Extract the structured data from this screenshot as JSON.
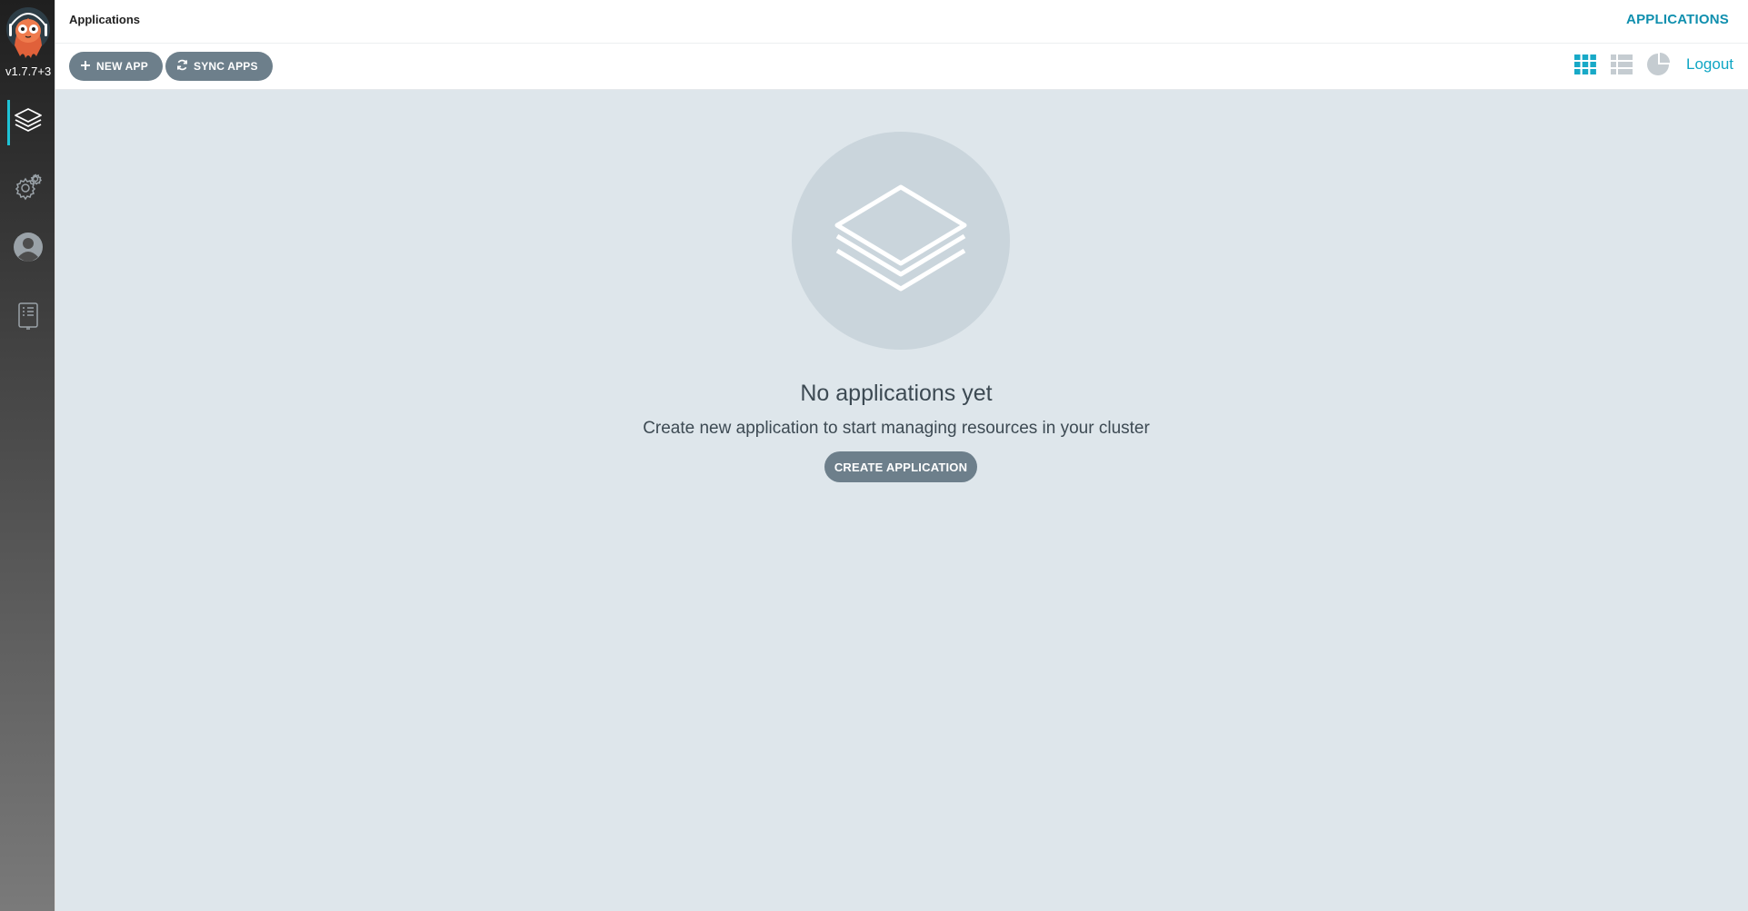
{
  "sidebar": {
    "version": "v1.7.7+3",
    "items": [
      {
        "name": "applications",
        "icon": "layers-icon"
      },
      {
        "name": "settings",
        "icon": "gear-icon"
      },
      {
        "name": "user-info",
        "icon": "user-icon"
      },
      {
        "name": "docs",
        "icon": "book-icon"
      }
    ]
  },
  "header": {
    "title": "Applications",
    "section": "APPLICATIONS"
  },
  "toolbar": {
    "new_app_label": "NEW APP",
    "sync_apps_label": "SYNC APPS",
    "logout_label": "Logout",
    "views": [
      "tiles-view-icon",
      "list-view-icon",
      "summary-view-icon"
    ],
    "active_view": "tiles"
  },
  "empty_state": {
    "title": "No applications yet",
    "subtitle": "Create new application to start managing resources in your cluster",
    "button_label": "CREATE APPLICATION"
  },
  "colors": {
    "accent": "#1ec3d6",
    "button": "#6d7f8b",
    "background": "#dee6eb",
    "link": "#0f8fae"
  }
}
